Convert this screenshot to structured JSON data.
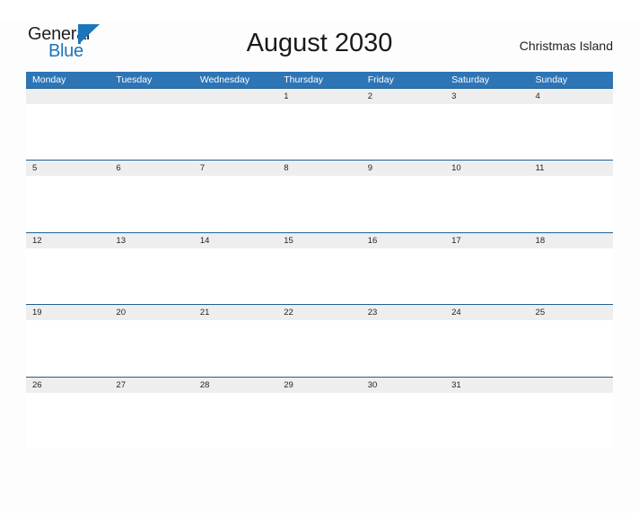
{
  "logo": {
    "word_top": "General",
    "word_bottom": "Blue",
    "flag_icon": "blue-triangle-flag-icon",
    "top_color": "#231f20",
    "bottom_color": "#1b75bb"
  },
  "header": {
    "title": "August 2030",
    "region": "Christmas Island"
  },
  "colors": {
    "header_blue": "#2e75b6",
    "row_divider_blue": "#1f6094",
    "date_band_gray": "#eeeeee",
    "text_dark": "#231f20",
    "page_background": "#fdfdfd"
  },
  "calendar": {
    "month": "August",
    "year": "2030",
    "weekdays": [
      "Monday",
      "Tuesday",
      "Wednesday",
      "Thursday",
      "Friday",
      "Saturday",
      "Sunday"
    ],
    "weeks": [
      [
        "",
        "",
        "",
        "1",
        "2",
        "3",
        "4"
      ],
      [
        "5",
        "6",
        "7",
        "8",
        "9",
        "10",
        "11"
      ],
      [
        "12",
        "13",
        "14",
        "15",
        "16",
        "17",
        "18"
      ],
      [
        "19",
        "20",
        "21",
        "22",
        "23",
        "24",
        "25"
      ],
      [
        "26",
        "27",
        "28",
        "29",
        "30",
        "31",
        ""
      ]
    ]
  }
}
